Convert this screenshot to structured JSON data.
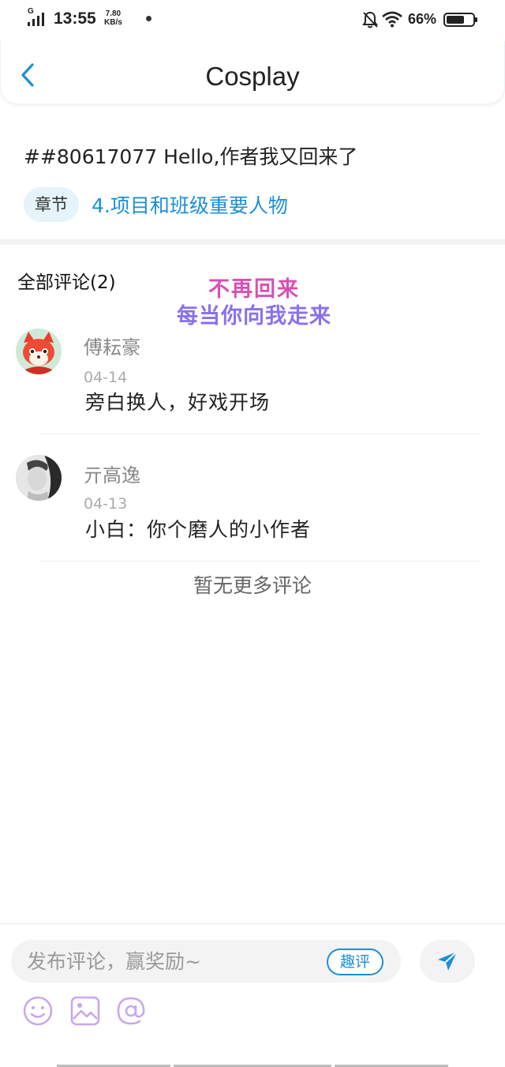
{
  "status_bar": {
    "network": "G",
    "time": "13:55",
    "speed_value": "7.80",
    "speed_unit": "KB/s",
    "battery": "66%"
  },
  "header": {
    "title": "Cosplay"
  },
  "post": {
    "title": "##80617077 Hello,作者我又回来了",
    "chapter_tag": "章节",
    "chapter_link": "4.项目和班级重要人物"
  },
  "comments_section": {
    "heading": "全部评论(2)",
    "sticker_line1": "不再回来",
    "sticker_line2": "每当你向我走来",
    "items": [
      {
        "name": "傅耘豪",
        "date": "04-14",
        "text": "旁白换人，好戏开场"
      },
      {
        "name": "亓高逸",
        "date": "04-13",
        "text": "小白：你个磨人的小作者"
      }
    ],
    "no_more": "暂无更多评论"
  },
  "input_bar": {
    "placeholder": "发布评论，赢奖励~",
    "fun_comment_label": "趣评"
  },
  "colors": {
    "accent": "#1a8fd6",
    "tag_bg": "#e5f4fb",
    "tool_icon": "#c9a6ea"
  },
  "icons": [
    "back-icon",
    "send-icon",
    "emoji-icon",
    "image-icon",
    "mention-icon"
  ]
}
